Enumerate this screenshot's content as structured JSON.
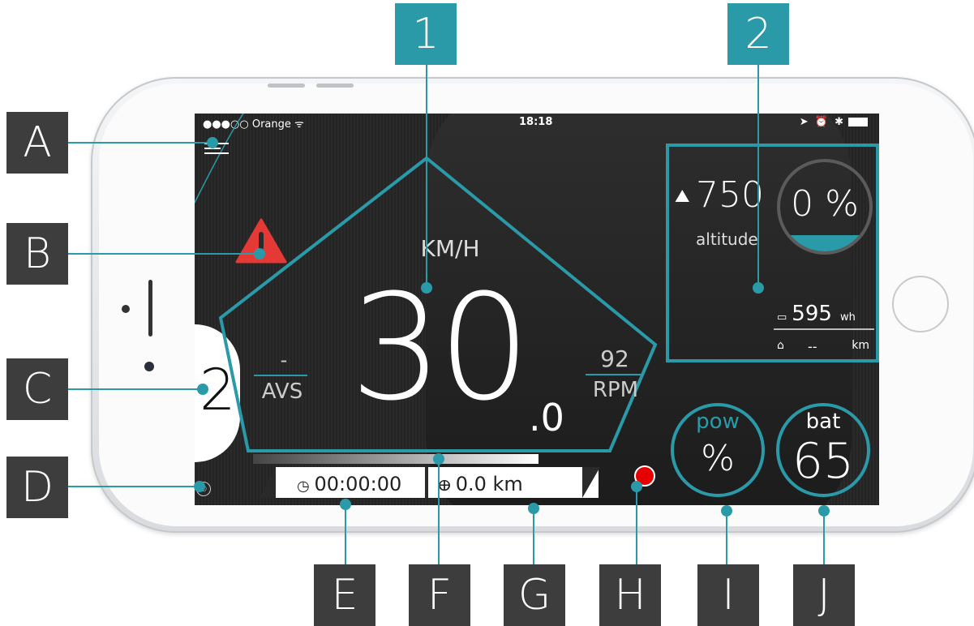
{
  "callouts_letters": [
    "A",
    "B",
    "C",
    "D",
    "E",
    "F",
    "G",
    "H",
    "I",
    "J"
  ],
  "callouts_numbers": [
    "1",
    "2"
  ],
  "statusbar": {
    "carrier": "●●●○○ Orange ᯤ",
    "time": "18:18",
    "right_icons": "➤ ⏰ ✱"
  },
  "speed": {
    "unit": "KM/H",
    "value": "30",
    "decimal": ".0"
  },
  "avs": {
    "value": "-",
    "label": "AVS"
  },
  "rpm": {
    "value": "92",
    "label": "RPM"
  },
  "altitude": {
    "value": "750",
    "label": "altitude",
    "icon": "mountain-icon"
  },
  "grade": {
    "value": "0 %",
    "fill_fraction": 0.18
  },
  "energy": {
    "value": "595",
    "unit": "wh"
  },
  "range": {
    "value": "--",
    "unit": "km"
  },
  "gear": {
    "value": "2"
  },
  "power": {
    "label": "pow",
    "value": "%"
  },
  "battery": {
    "label": "bat",
    "value": "65"
  },
  "timer": {
    "value": "00:00:00"
  },
  "distance": {
    "value": "0.0 km"
  },
  "colors": {
    "accent": "#2a9aa9",
    "callout": "#3d3d3d",
    "record": "#e60000",
    "warning": "#e53935"
  }
}
